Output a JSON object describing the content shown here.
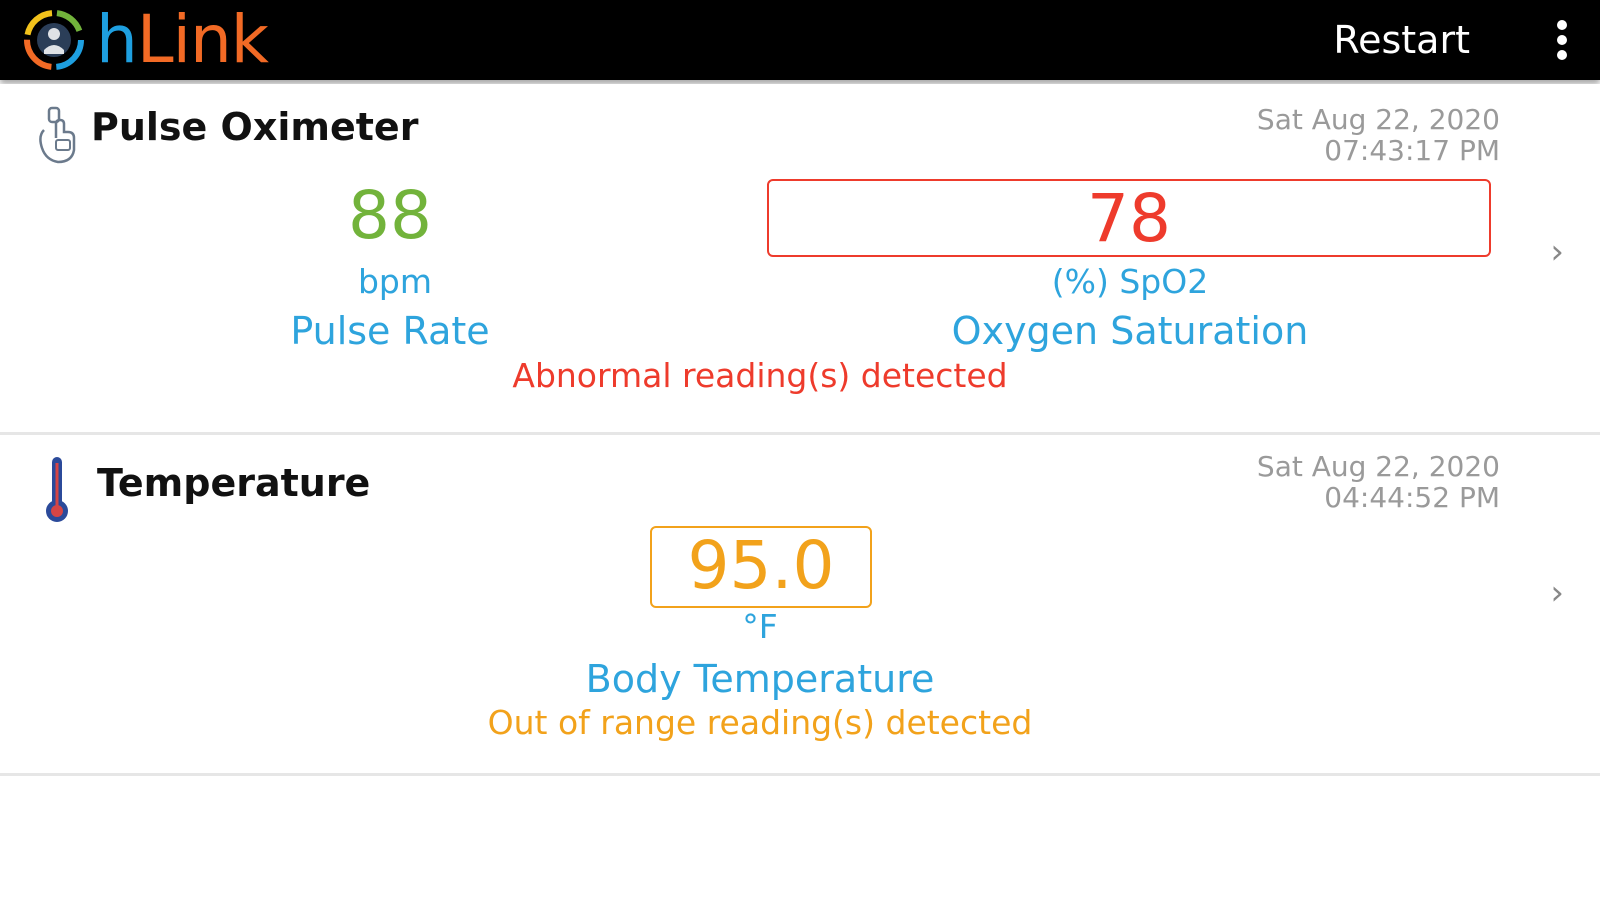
{
  "app": {
    "logo_h": "h",
    "logo_link": "Link",
    "restart_label": "Restart",
    "menu_icon": "more-vertical-icon"
  },
  "pulse_oximeter": {
    "icon": "finger-oximeter-icon",
    "title": "Pulse Oximeter",
    "date": "Sat Aug 22, 2020",
    "time": "07:43:17 PM",
    "pulse_rate": {
      "value": "88",
      "unit": "bpm",
      "label": "Pulse Rate",
      "color": "#72b33b"
    },
    "spo2": {
      "value": "78",
      "unit": "(%) SpO2",
      "label": "Oxygen Saturation",
      "color": "#ee3b2c"
    },
    "alert": "Abnormal reading(s) detected",
    "alert_color": "#ee3b2c"
  },
  "temperature": {
    "icon": "thermometer-icon",
    "title": "Temperature",
    "date": "Sat Aug 22, 2020",
    "time": "04:44:52 PM",
    "body_temp": {
      "value": "95.0",
      "unit": "°F",
      "label": "Body Temperature",
      "color": "#f2a21b"
    },
    "alert": "Out of range reading(s) detected",
    "alert_color": "#f2a21b"
  },
  "colors": {
    "topbar": "#000000",
    "accent_blue": "#2ea4dd",
    "logo_blue": "#1e9fe0",
    "logo_orange": "#f26a25"
  }
}
